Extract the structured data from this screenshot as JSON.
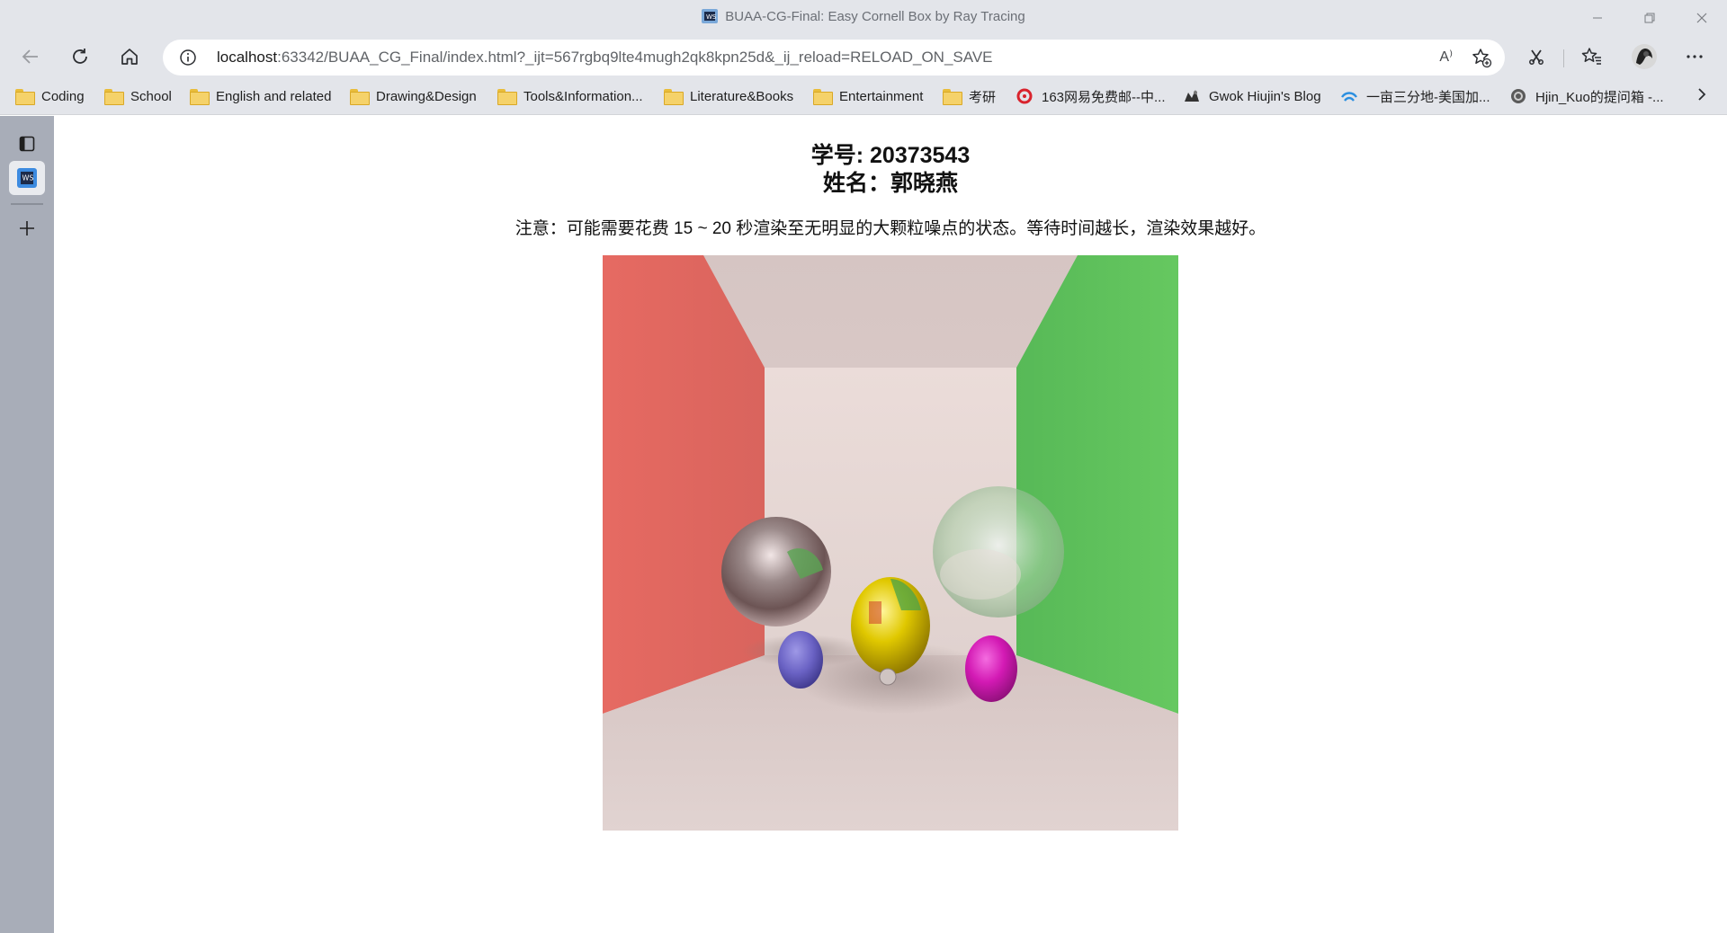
{
  "window": {
    "title": "BUAA-CG-Final: Easy Cornell Box by Ray Tracing",
    "controls": [
      "minimize",
      "restore",
      "close"
    ]
  },
  "toolbar": {
    "url_host": "localhost",
    "url_rest": ":63342/BUAA_CG_Final/index.html?_ijt=567rgbq9lte4mugh2qk8kpn25d&_ij_reload=RELOAD_ON_SAVE",
    "read_aloud_label": "A⁾"
  },
  "bookmarks": [
    {
      "label": "Coding",
      "icon": "folder-icon"
    },
    {
      "label": "School",
      "icon": "folder-icon"
    },
    {
      "label": "English and related",
      "icon": "folder-icon"
    },
    {
      "label": "Drawing&Design",
      "icon": "folder-icon"
    },
    {
      "label": "Tools&Information...",
      "icon": "folder-icon"
    },
    {
      "label": "Literature&Books",
      "icon": "folder-icon"
    },
    {
      "label": "Entertainment",
      "icon": "folder-icon"
    },
    {
      "label": "考研",
      "icon": "folder-icon"
    },
    {
      "label": "163网易免费邮--中...",
      "icon": "mail163-icon"
    },
    {
      "label": "Gwok Hiujin's Blog",
      "icon": "blog-icon"
    },
    {
      "label": "一亩三分地-美国加...",
      "icon": "bbs-icon"
    },
    {
      "label": "Hjin_Kuo的提问箱 -...",
      "icon": "question-box-icon"
    }
  ],
  "page": {
    "student_id": "学号: 20373543",
    "student_name": "姓名：郭晓燕",
    "notice": "注意：可能需要花费 15 ~ 20 秒渲染至无明显的大颗粒噪点的状态。等待时间越长，渲染效果越好。",
    "render_image": "cornell-box-render"
  },
  "colors": {
    "chrome_bg": "#e3e5ea",
    "sidebar_bg": "#a8adb8",
    "left_wall": "#e0675f",
    "right_wall": "#5cc25a",
    "back_wall": "#e8dbd8",
    "yellow_sphere": "#e6cf00",
    "magenta_sphere": "#d81ab5",
    "blue_sphere": "#6a62c4"
  }
}
